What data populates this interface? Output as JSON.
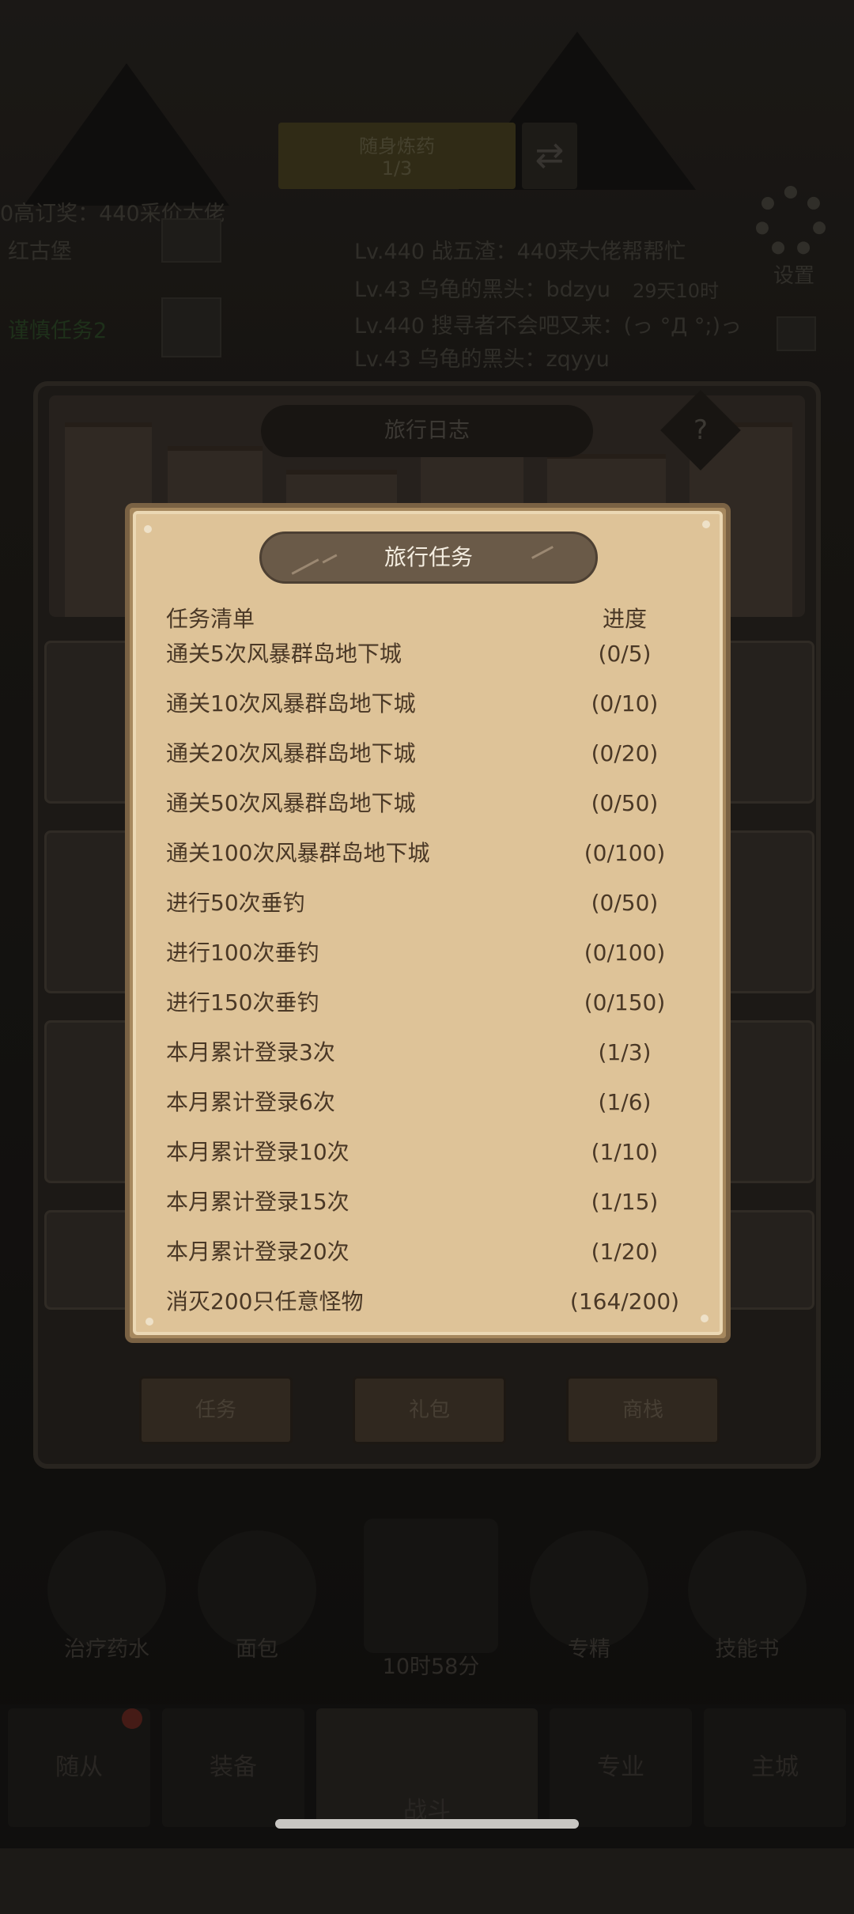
{
  "background": {
    "banner_line1": "随身炼药",
    "banner_line2": "1/3",
    "left_text1": "0高订奖：440采价大佬",
    "left_text2": "红古堡",
    "left_text3": "谨慎任务2",
    "chat_lines": [
      "Lv.440 战五渣：440来大佬帮帮忙",
      "Lv.43 乌龟的黑头：bdzyu",
      "Lv.440 搜寻者不会吧又来：(っ °Д °;)っ",
      "Lv.43 乌龟的黑头：zqyyu"
    ],
    "timer_small": "29天10时",
    "settings_label": "设置",
    "panel_title": "旅行日志",
    "help_glyph": "?",
    "bottom_buttons": [
      "任务",
      "礼包",
      "商栈"
    ],
    "items": [
      {
        "label": "治疗药水",
        "icon": "potion-icon"
      },
      {
        "label": "面包",
        "icon": "bread-icon"
      },
      {
        "label": "10时58分",
        "icon": "cart-icon"
      },
      {
        "label": "专精",
        "icon": "rooster-icon"
      },
      {
        "label": "技能书",
        "icon": "book-icon"
      }
    ],
    "nav": [
      "随从",
      "装备",
      "战斗",
      "专业",
      "主城"
    ],
    "colors": {
      "accent_green": "#2f4a28",
      "badge_red": "#6b2a22"
    }
  },
  "modal": {
    "title": "旅行任务",
    "header_name": "任务清单",
    "header_progress": "进度",
    "tasks": [
      {
        "name": "通关5次风暴群岛地下城",
        "progress": "(0/5)"
      },
      {
        "name": "通关10次风暴群岛地下城",
        "progress": "(0/10)"
      },
      {
        "name": "通关20次风暴群岛地下城",
        "progress": "(0/20)"
      },
      {
        "name": "通关50次风暴群岛地下城",
        "progress": "(0/50)"
      },
      {
        "name": "通关100次风暴群岛地下城",
        "progress": "(0/100)"
      },
      {
        "name": "进行50次垂钓",
        "progress": "(0/50)"
      },
      {
        "name": "进行100次垂钓",
        "progress": "(0/100)"
      },
      {
        "name": "进行150次垂钓",
        "progress": "(0/150)"
      },
      {
        "name": "本月累计登录3次",
        "progress": "(1/3)"
      },
      {
        "name": "本月累计登录6次",
        "progress": "(1/6)"
      },
      {
        "name": "本月累计登录10次",
        "progress": "(1/10)"
      },
      {
        "name": "本月累计登录15次",
        "progress": "(1/15)"
      },
      {
        "name": "本月累计登录20次",
        "progress": "(1/20)"
      },
      {
        "name": "消灭200只任意怪物",
        "progress": "(164/200)"
      }
    ],
    "colors": {
      "parchment": "#dec398",
      "frame": "#7a6244",
      "text": "#4a3826",
      "title_bg": "#6a5a48"
    }
  }
}
